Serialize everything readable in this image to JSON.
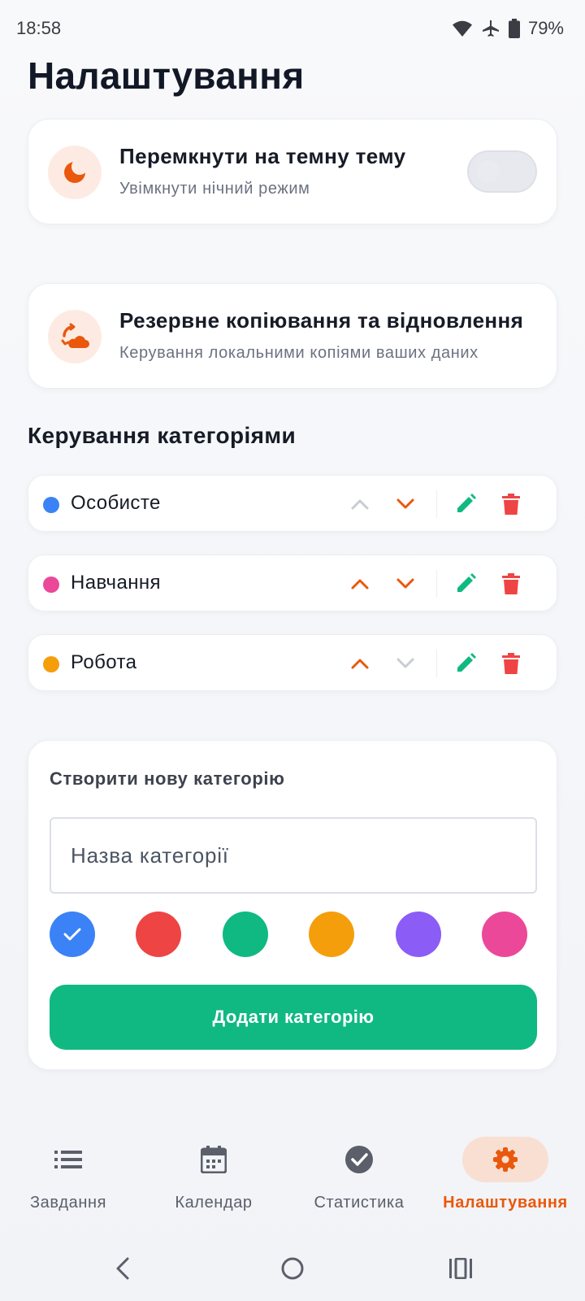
{
  "status": {
    "time": "18:58",
    "battery": "79%"
  },
  "page": {
    "title": "Налаштування"
  },
  "settings": {
    "theme": {
      "title": "Перемкнути на темну тему",
      "subtitle": "Увімкнути нічний режим",
      "enabled": false
    },
    "backup": {
      "title": "Резервне копіювання та відновлення",
      "subtitle": "Керування локальними копіями ваших даних"
    }
  },
  "categories": {
    "title": "Керування категоріями",
    "items": [
      {
        "name": "Особисте",
        "color": "#3b82f6",
        "up_enabled": false,
        "down_enabled": true
      },
      {
        "name": "Навчання",
        "color": "#ec4899",
        "up_enabled": true,
        "down_enabled": true
      },
      {
        "name": "Робота",
        "color": "#f59e0b",
        "up_enabled": true,
        "down_enabled": false
      }
    ]
  },
  "new_category": {
    "title": "Створити нову категорію",
    "placeholder": "Назва категорії",
    "value": "",
    "colors": [
      "#3b82f6",
      "#ef4444",
      "#10b981",
      "#f59e0b",
      "#8b5cf6",
      "#ec4899"
    ],
    "selected_color": "#3b82f6",
    "add_label": "Додати категорію"
  },
  "nav": {
    "items": [
      {
        "label": "Завдання",
        "icon": "list-icon",
        "active": false
      },
      {
        "label": "Календар",
        "icon": "calendar-icon",
        "active": false
      },
      {
        "label": "Статистика",
        "icon": "check-circle-icon",
        "active": false
      },
      {
        "label": "Налаштування",
        "icon": "gear-icon",
        "active": true
      }
    ]
  },
  "colors": {
    "accent": "#ea580c",
    "success": "#10b981",
    "danger": "#ef4444",
    "disabled": "#c9ccd3"
  }
}
